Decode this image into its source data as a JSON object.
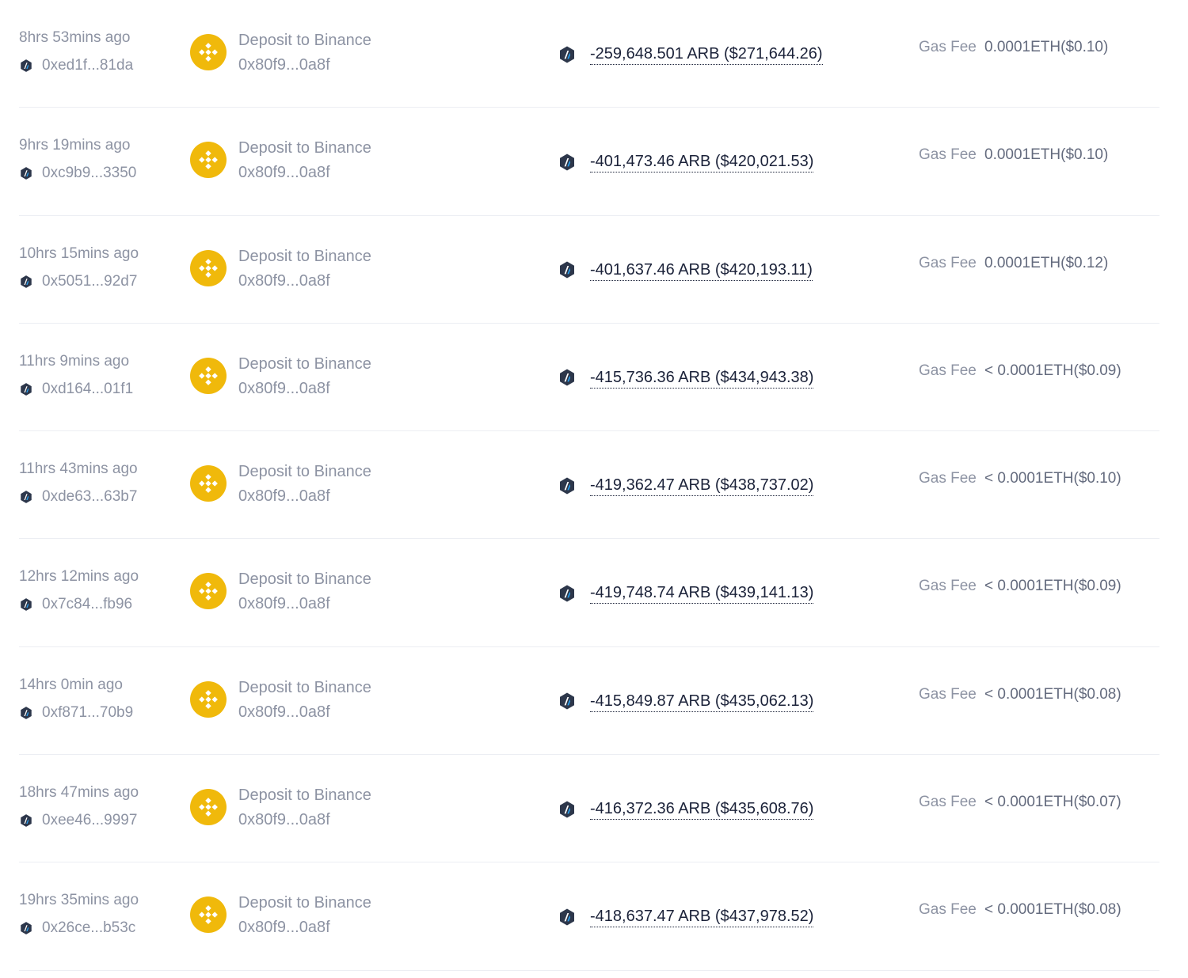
{
  "colors": {
    "muted_text": "#8d93a3",
    "dark_text": "#1b2239",
    "gas_value_text": "#646b7e",
    "binance_yellow": "#f0b90b",
    "arbitrum_navy": "#2d374b",
    "arbitrum_blue": "#28a0f0",
    "divider": "#eceef3"
  },
  "icons": {
    "source_chain": "arbitrum-icon",
    "destination": "binance-icon",
    "token": "arbitrum-icon"
  },
  "transactions": [
    {
      "time": "8hrs 53mins ago",
      "hash": "0xed1f...81da",
      "dest_label": "Deposit to Binance",
      "dest_address": "0x80f9...0a8f",
      "amount": "-259,648.501 ARB ($271,644.26)",
      "gas_label": "Gas Fee",
      "gas_value": "0.0001ETH($0.10)"
    },
    {
      "time": "9hrs 19mins ago",
      "hash": "0xc9b9...3350",
      "dest_label": "Deposit to Binance",
      "dest_address": "0x80f9...0a8f",
      "amount": "-401,473.46 ARB ($420,021.53)",
      "gas_label": "Gas Fee",
      "gas_value": "0.0001ETH($0.10)"
    },
    {
      "time": "10hrs 15mins ago",
      "hash": "0x5051...92d7",
      "dest_label": "Deposit to Binance",
      "dest_address": "0x80f9...0a8f",
      "amount": "-401,637.46 ARB ($420,193.11)",
      "gas_label": "Gas Fee",
      "gas_value": "0.0001ETH($0.12)"
    },
    {
      "time": "11hrs 9mins ago",
      "hash": "0xd164...01f1",
      "dest_label": "Deposit to Binance",
      "dest_address": "0x80f9...0a8f",
      "amount": "-415,736.36 ARB ($434,943.38)",
      "gas_label": "Gas Fee",
      "gas_value": "< 0.0001ETH($0.09)"
    },
    {
      "time": "11hrs 43mins ago",
      "hash": "0xde63...63b7",
      "dest_label": "Deposit to Binance",
      "dest_address": "0x80f9...0a8f",
      "amount": "-419,362.47 ARB ($438,737.02)",
      "gas_label": "Gas Fee",
      "gas_value": "< 0.0001ETH($0.10)"
    },
    {
      "time": "12hrs 12mins ago",
      "hash": "0x7c84...fb96",
      "dest_label": "Deposit to Binance",
      "dest_address": "0x80f9...0a8f",
      "amount": "-419,748.74 ARB ($439,141.13)",
      "gas_label": "Gas Fee",
      "gas_value": "< 0.0001ETH($0.09)"
    },
    {
      "time": "14hrs 0min ago",
      "hash": "0xf871...70b9",
      "dest_label": "Deposit to Binance",
      "dest_address": "0x80f9...0a8f",
      "amount": "-415,849.87 ARB ($435,062.13)",
      "gas_label": "Gas Fee",
      "gas_value": "< 0.0001ETH($0.08)"
    },
    {
      "time": "18hrs 47mins ago",
      "hash": "0xee46...9997",
      "dest_label": "Deposit to Binance",
      "dest_address": "0x80f9...0a8f",
      "amount": "-416,372.36 ARB ($435,608.76)",
      "gas_label": "Gas Fee",
      "gas_value": "< 0.0001ETH($0.07)"
    },
    {
      "time": "19hrs 35mins ago",
      "hash": "0x26ce...b53c",
      "dest_label": "Deposit to Binance",
      "dest_address": "0x80f9...0a8f",
      "amount": "-418,637.47 ARB ($437,978.52)",
      "gas_label": "Gas Fee",
      "gas_value": "< 0.0001ETH($0.08)"
    }
  ]
}
